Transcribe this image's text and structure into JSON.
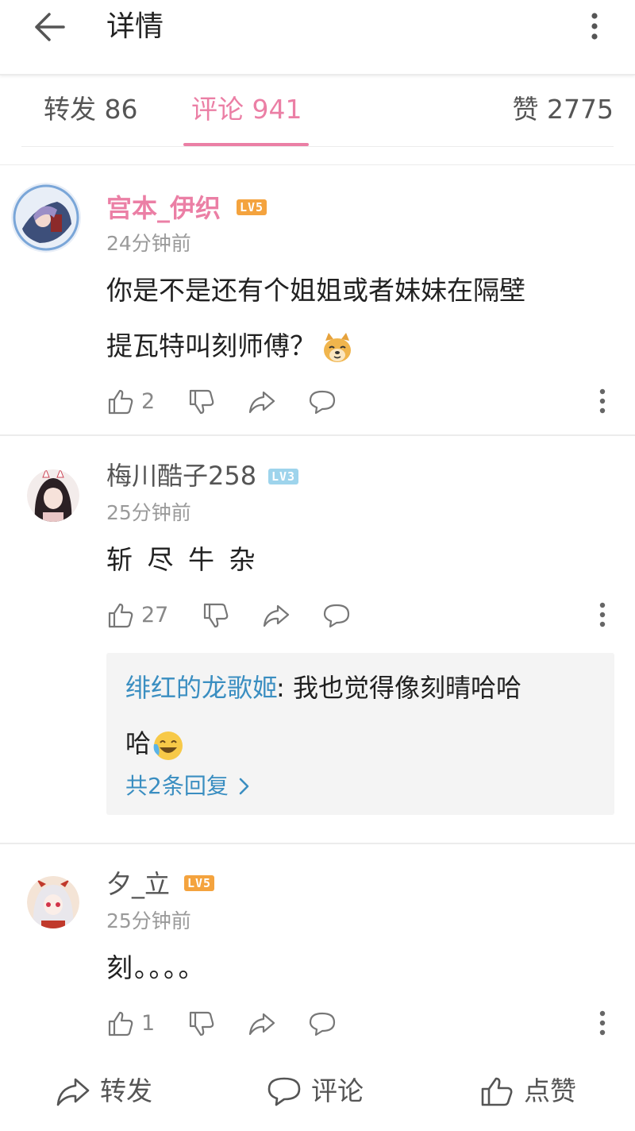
{
  "header": {
    "title": "详情"
  },
  "tabs": {
    "repost": "转发 86",
    "comment": "评论 941",
    "like": "赞 2775"
  },
  "colors": {
    "accent": "#eb7fa5",
    "link": "#3a8ec1",
    "level_orange": "#f4a33e",
    "level_blue": "#9ed4ec"
  },
  "comments": [
    {
      "username": "宫本_伊织",
      "level": "LV5",
      "time": "24分钟前",
      "text_line1": "你是不是还有个姐姐或者妹妹在隔壁",
      "text_line2": "提瓦特叫刻师傅？",
      "emoji": "doge-emoji",
      "likes": "2"
    },
    {
      "username": "梅川酷子258",
      "level": "LV3",
      "time": "25分钟前",
      "text_line1": "斩 尽 牛 杂",
      "likes": "27",
      "reply": {
        "name": "绯红的龙歌姬",
        "text_line1": ": 我也觉得像刻晴哈哈",
        "text_line2": "哈",
        "emoji": "laugh-cry-emoji",
        "more": "共2条回复"
      }
    },
    {
      "username": "夕_立",
      "level": "LV5",
      "time": "25分钟前",
      "text_line1": "刻。。。。",
      "likes": "1"
    }
  ],
  "bottom": {
    "repost": "转发",
    "comment": "评论",
    "like": "点赞"
  }
}
